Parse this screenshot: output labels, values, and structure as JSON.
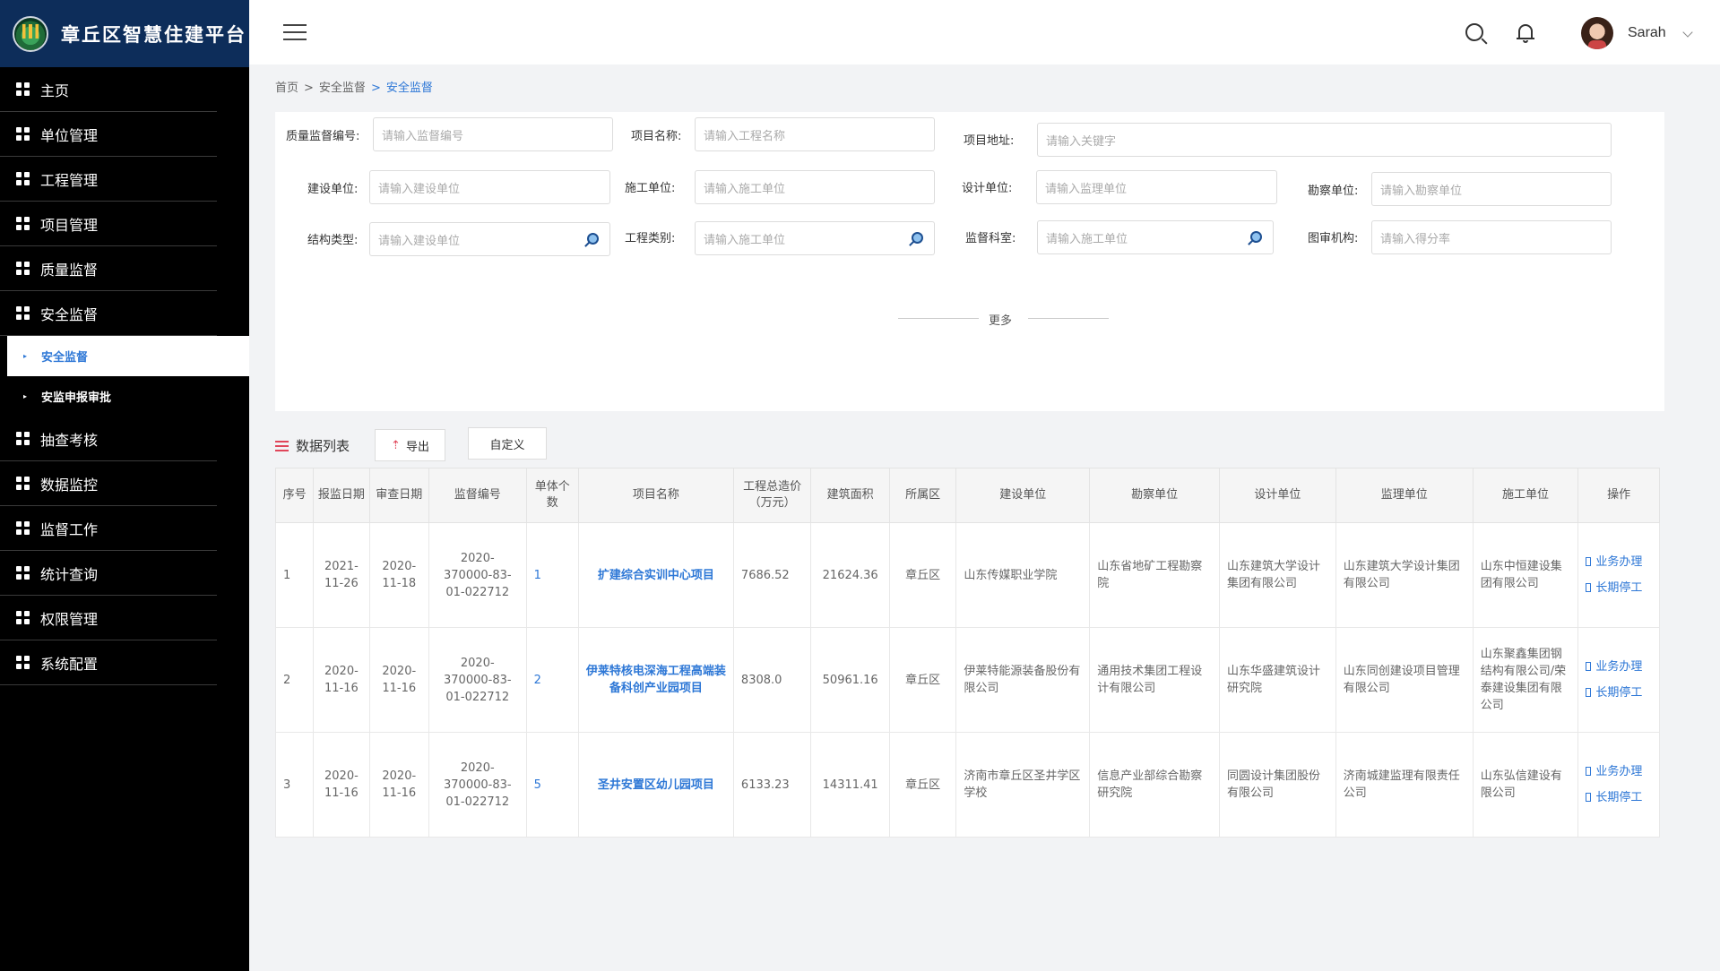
{
  "app": {
    "title": "章丘区智慧住建平台"
  },
  "header": {
    "username": "Sarah"
  },
  "sidebar": {
    "items": [
      {
        "label": "主页"
      },
      {
        "label": "单位管理"
      },
      {
        "label": "工程管理"
      },
      {
        "label": "项目管理"
      },
      {
        "label": "质量监督"
      },
      {
        "label": "安全监督"
      }
    ],
    "sub_items": [
      {
        "label": "安全监督",
        "active": true
      },
      {
        "label": "安监申报审批",
        "active": false
      }
    ],
    "items_after": [
      {
        "label": "抽查考核"
      },
      {
        "label": "数据监控"
      },
      {
        "label": "监督工作"
      },
      {
        "label": "统计查询"
      },
      {
        "label": "权限管理"
      },
      {
        "label": "系统配置"
      }
    ]
  },
  "breadcrumb": {
    "home": "首页",
    "parent": "安全监督",
    "current": "安全监督",
    "sep": ">"
  },
  "filters": {
    "quality_no": {
      "label": "质量监督编号:",
      "placeholder": "请输入监督编号"
    },
    "project_name": {
      "label": "项目名称:",
      "placeholder": "请输入工程名称"
    },
    "project_address": {
      "label": "项目地址:",
      "placeholder": "请输入关键字"
    },
    "builder": {
      "label": "建设单位:",
      "placeholder": "请输入建设单位"
    },
    "constructor": {
      "label": "施工单位:",
      "placeholder": "请输入施工单位"
    },
    "designer": {
      "label": "设计单位:",
      "placeholder": "请输入监理单位"
    },
    "surveyor": {
      "label": "勘察单位:",
      "placeholder": "请输入勘察单位"
    },
    "structure_type": {
      "label": "结构类型:",
      "placeholder": "请输入建设单位"
    },
    "project_category": {
      "label": "工程类别:",
      "placeholder": "请输入施工单位"
    },
    "supervision_dept": {
      "label": "监督科室:",
      "placeholder": "请输入施工单位"
    },
    "review_org": {
      "label": "图审机构:",
      "placeholder": "请输入得分率"
    },
    "more": "更多"
  },
  "list": {
    "title": "数据列表",
    "export_label": "导出",
    "custom_label": "自定义",
    "columns": [
      "序号",
      "报监日期",
      "审查日期",
      "监督编号",
      "单体个数",
      "项目名称",
      "工程总造价（万元）",
      "建筑面积",
      "所属区",
      "建设单位",
      "勘察单位",
      "设计单位",
      "监理单位",
      "施工单位",
      "操作"
    ],
    "rows": [
      {
        "no": "1",
        "report_date": "2021-11-26",
        "review_date": "2020-11-18",
        "code": "2020-370000-83-01-022712",
        "units": "1",
        "project": "扩建综合实训中心项目",
        "cost": "7686.52",
        "area": "21624.36",
        "district": "章丘区",
        "builder": "山东传媒职业学院",
        "surveyor": "山东省地矿工程勘察院",
        "designer": "山东建筑大学设计集团有限公司",
        "supervisor": "山东建筑大学设计集团有限公司",
        "constructor": "山东中恒建设集团有限公司"
      },
      {
        "no": "2",
        "report_date": "2020-11-16",
        "review_date": "2020-11-16",
        "code": "2020-370000-83-01-022712",
        "units": "2",
        "project": "伊莱特核电深海工程高端装备科创产业园项目",
        "cost": "8308.0",
        "area": "50961.16",
        "district": "章丘区",
        "builder": "伊莱特能源装备股份有限公司",
        "surveyor": "通用技术集团工程设计有限公司",
        "designer": "山东华盛建筑设计研究院",
        "supervisor": "山东同创建设项目管理有限公司",
        "constructor": "山东聚鑫集团钢结构有限公司/荣泰建设集团有限公司"
      },
      {
        "no": "3",
        "report_date": "2020-11-16",
        "review_date": "2020-11-16",
        "code": "2020-370000-83-01-022712",
        "units": "5",
        "project": "圣井安置区幼儿园项目",
        "cost": "6133.23",
        "area": "14311.41",
        "district": "章丘区",
        "builder": "济南市章丘区圣井学区学校",
        "surveyor": "信息产业部综合勘察研究院",
        "designer": "同圆设计集团股份有限公司",
        "supervisor": "济南城建监理有限责任公司",
        "constructor": "山东弘信建设有限公司"
      }
    ],
    "ops": [
      "业务办理",
      "长期停工"
    ]
  }
}
